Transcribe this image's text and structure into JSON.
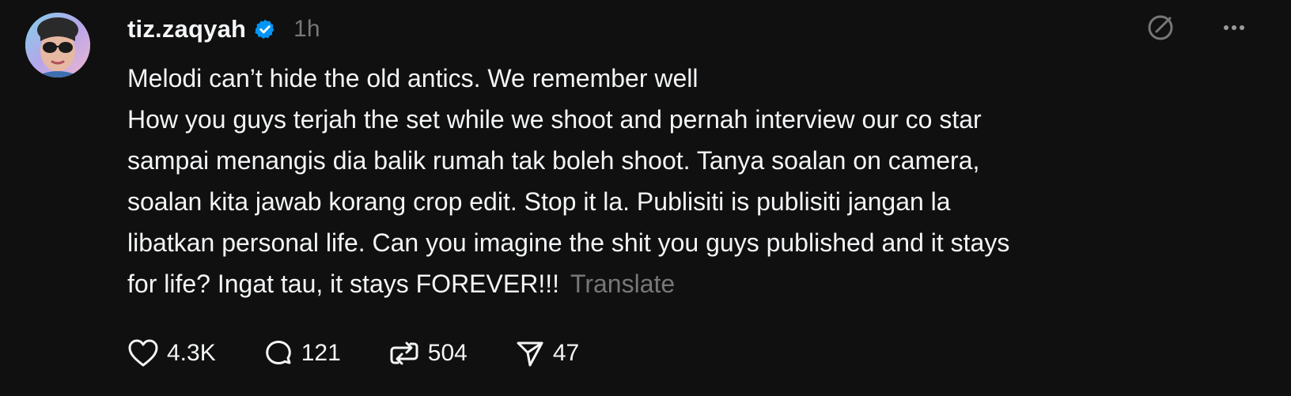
{
  "post": {
    "author": {
      "username": "tiz.zaqyah",
      "verified": true,
      "avatar_icon": "avatar-photo"
    },
    "timestamp": "1h",
    "body_lines": [
      "Melodi can’t hide the old antics. We remember well",
      "How you guys terjah the set while we shoot and pernah interview our co star",
      "sampai menangis dia balik rumah tak boleh shoot. Tanya soalan on camera,",
      "soalan kita jawab korang crop edit. Stop it la. Publisiti is publisiti jangan la",
      "libatkan personal life. Can you imagine the shit you guys published and it stays",
      "for life? Ingat tau, it stays FOREVER!!!"
    ],
    "translate_label": "Translate",
    "actions": {
      "like": {
        "icon": "heart-icon",
        "count": "4.3K"
      },
      "reply": {
        "icon": "comment-icon",
        "count": "121"
      },
      "repost": {
        "icon": "repost-icon",
        "count": "504"
      },
      "share": {
        "icon": "send-icon",
        "count": "47"
      }
    },
    "top_icons": [
      "edit-icon",
      "more-options-icon"
    ]
  },
  "colors": {
    "background": "#101010",
    "primary_text": "#f3f5f7",
    "secondary_text": "#777777",
    "verified_badge": "#0095f6"
  }
}
